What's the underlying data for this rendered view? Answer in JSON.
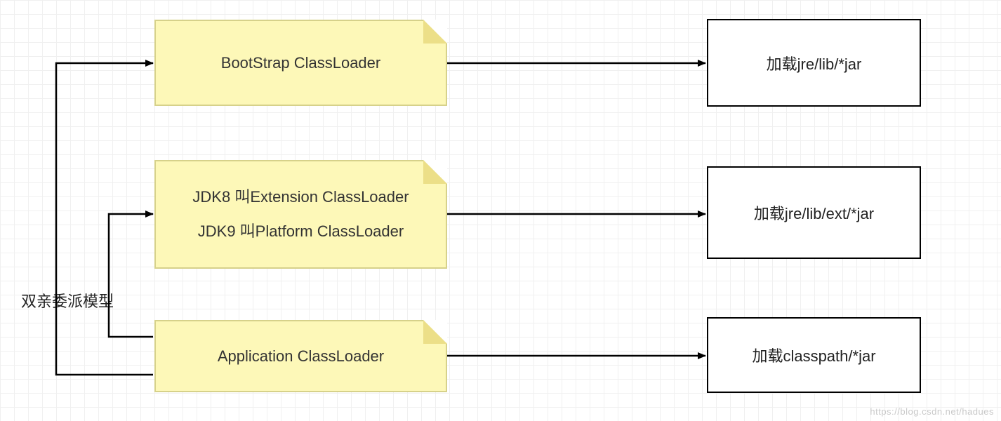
{
  "nodes": {
    "bootstrap": {
      "label": "BootStrap ClassLoader"
    },
    "extension": {
      "line1": "JDK8 叫Extension ClassLoader",
      "line2": "JDK9 叫Platform ClassLoader"
    },
    "application": {
      "label": "Application ClassLoader"
    }
  },
  "targets": {
    "jre_lib": "加载jre/lib/*jar",
    "jre_lib_ext": "加载jre/lib/ext/*jar",
    "classpath": "加载classpath/*jar"
  },
  "label": {
    "delegation": "双亲委派模型"
  },
  "watermark": "https://blog.csdn.net/hadues"
}
